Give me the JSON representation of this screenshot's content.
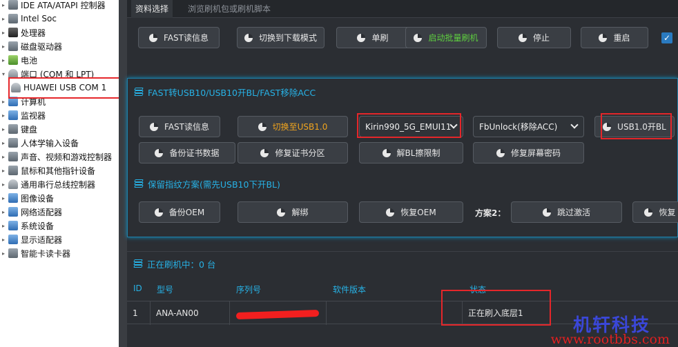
{
  "device_manager": {
    "items": [
      {
        "label": "IDE ATA/ATAPI 控制器",
        "icon": "ide-controller-icon"
      },
      {
        "label": "Intel Soc",
        "icon": "chip-icon"
      },
      {
        "label": "处理器",
        "icon": "processor-icon"
      },
      {
        "label": "磁盘驱动器",
        "icon": "disk-icon"
      },
      {
        "label": "电池",
        "icon": "battery-icon"
      },
      {
        "label": "端口 (COM 和 LPT)",
        "icon": "port-icon"
      },
      {
        "label": "HUAWEI USB COM 1",
        "icon": "usb-port-icon",
        "child": true
      },
      {
        "label": "计算机",
        "icon": "computer-icon"
      },
      {
        "label": "监视器",
        "icon": "monitor-icon"
      },
      {
        "label": "键盘",
        "icon": "keyboard-icon"
      },
      {
        "label": "人体学输入设备",
        "icon": "hid-icon"
      },
      {
        "label": "声音、视频和游戏控制器",
        "icon": "sound-icon"
      },
      {
        "label": "鼠标和其他指针设备",
        "icon": "mouse-icon"
      },
      {
        "label": "通用串行总线控制器",
        "icon": "usb-controller-icon"
      },
      {
        "label": "图像设备",
        "icon": "camera-icon"
      },
      {
        "label": "网络适配器",
        "icon": "network-icon"
      },
      {
        "label": "系统设备",
        "icon": "system-icon"
      },
      {
        "label": "显示适配器",
        "icon": "display-adapter-icon"
      },
      {
        "label": "智能卡读卡器",
        "icon": "smartcard-icon"
      }
    ]
  },
  "tabs": {
    "active": "资料选择",
    "inactive": "浏览刷机包或刷机脚本"
  },
  "top_toolbar": {
    "fast_read": "FAST读信息",
    "switch_download": "切换到下载模式",
    "single_flash": "单刷",
    "batch_flash": "启动批量刷机",
    "stop": "停止",
    "restart": "重启",
    "checkbox": "✓"
  },
  "section_usb": {
    "title": "FAST转USB10/USB10开BL/FAST移除ACC",
    "fast_read": "FAST读信息",
    "switch_usb": "切换至USB1.0",
    "model_select": "Kirin990_5G_EMUI11",
    "unlock_select": "FbUnlock(移除ACC)",
    "usb_open_bl": "USB1.0开BL",
    "backup_cert": "备份证书数据",
    "repair_cert": "修复证书分区",
    "unlock_bl": "解BL擦限制",
    "repair_screen": "修复屏幕密码"
  },
  "section_fingerprint": {
    "title": "保留指纹方案(需先USB10下开BL)",
    "backup_oem": "备份OEM",
    "unbind": "解绑",
    "restore_oem": "恢复OEM",
    "plan2_label": "方案2：",
    "skip_activation": "跳过激活",
    "restore_cut": "恢复"
  },
  "flashing": {
    "title": "正在刷机中：0 台",
    "columns": [
      "ID",
      "型号",
      "序列号",
      "软件版本",
      "状态"
    ],
    "rows": [
      {
        "id": "1",
        "model": "ANA-AN00",
        "serial": "",
        "version": "",
        "status": "正在刷入底层1"
      }
    ]
  },
  "watermark": {
    "cn": "机轩科技",
    "url": "www.rootbbs.com"
  },
  "colors": {
    "accent": "#27b2e6",
    "highlight": "#e5262a",
    "orange": "#f0a41e",
    "green": "#5fd13f"
  }
}
